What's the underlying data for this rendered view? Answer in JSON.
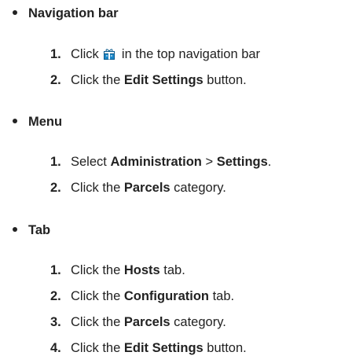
{
  "sections": [
    {
      "heading": "Navigation bar",
      "steps": [
        {
          "num": "1.",
          "pre": "Click ",
          "icon": "gift-box-icon",
          "post": " in the top navigation bar"
        },
        {
          "num": "2.",
          "pre": "Click the ",
          "bold": "Edit Settings",
          "post": " button."
        }
      ]
    },
    {
      "heading": "Menu",
      "steps": [
        {
          "num": "1.",
          "pre": "Select ",
          "bold": "Administration",
          "mid": " > ",
          "bold2": "Settings",
          "post": "."
        },
        {
          "num": "2.",
          "pre": "Click the ",
          "bold": "Parcels",
          "post": " category."
        }
      ]
    },
    {
      "heading": "Tab",
      "steps": [
        {
          "num": "1.",
          "pre": "Click the ",
          "bold": "Hosts",
          "post": " tab."
        },
        {
          "num": "2.",
          "pre": "Click the ",
          "bold": "Configuration",
          "post": " tab."
        },
        {
          "num": "3.",
          "pre": "Click the ",
          "bold": "Parcels",
          "post": " category."
        },
        {
          "num": "4.",
          "pre": "Click the ",
          "bold": "Edit Settings",
          "post": " button."
        }
      ]
    }
  ],
  "colors": {
    "text": "#222222",
    "icon_fill": "#1e88c8"
  }
}
